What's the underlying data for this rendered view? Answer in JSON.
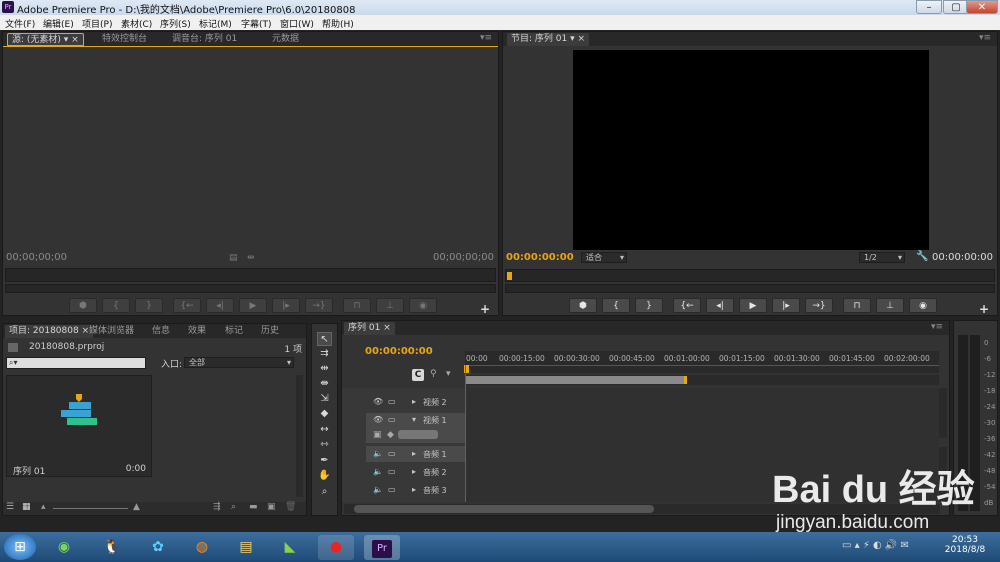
{
  "window": {
    "title": "Adobe Premiere Pro - D:\\我的文档\\Adobe\\Premiere Pro\\6.0\\20180808",
    "app_icon": "Pr",
    "minimize": "–",
    "maximize": "▢",
    "close": "✕"
  },
  "menu": [
    "文件(F)",
    "编辑(E)",
    "项目(P)",
    "素材(C)",
    "序列(S)",
    "标记(M)",
    "字幕(T)",
    "窗口(W)",
    "帮助(H)"
  ],
  "source_panel": {
    "tabs": [
      "源: (无素材)",
      "特效控制台",
      "调音台: 序列 01",
      "元数据"
    ],
    "timecode_left": "00;00;00;00",
    "timecode_right": "00;00;00;00"
  },
  "program_panel": {
    "tab": "节目: 序列 01",
    "timecode_left": "00:00:00:00",
    "timecode_right": "00:00:00:00",
    "fit_label": "适合",
    "resolution": "1/2"
  },
  "project_panel": {
    "tabs": [
      "项目: 20180808",
      "媒体浏览器",
      "信息",
      "效果",
      "标记",
      "历史"
    ],
    "filename": "20180808.prproj",
    "count": "1 项",
    "search_placeholder": "",
    "in_label": "入口:",
    "in_value": "全部",
    "item_name": "序列 01",
    "item_duration": "0:00"
  },
  "timeline_panel": {
    "tab": "序列 01",
    "timecode": "00:00:00:00",
    "ruler": [
      "00:00",
      "00:00:15:00",
      "00:00:30:00",
      "00:00:45:00",
      "00:01:00:00",
      "00:01:15:00",
      "00:01:30:00",
      "00:01:45:00",
      "00:02:00:00"
    ],
    "tracks": [
      "视频 2",
      "视频 1",
      "音频 1",
      "音频 2",
      "音频 3"
    ]
  },
  "audio_meter": {
    "labels": [
      "0",
      "-6",
      "-12",
      "-18",
      "-24",
      "-30",
      "-36",
      "-42",
      "-48",
      "-54",
      "dB"
    ]
  },
  "taskbar": {
    "time": "20:53",
    "date": "2018/8/8"
  },
  "watermark": {
    "brand": "Bai du 经验",
    "url": "jingyan.baidu.com"
  }
}
